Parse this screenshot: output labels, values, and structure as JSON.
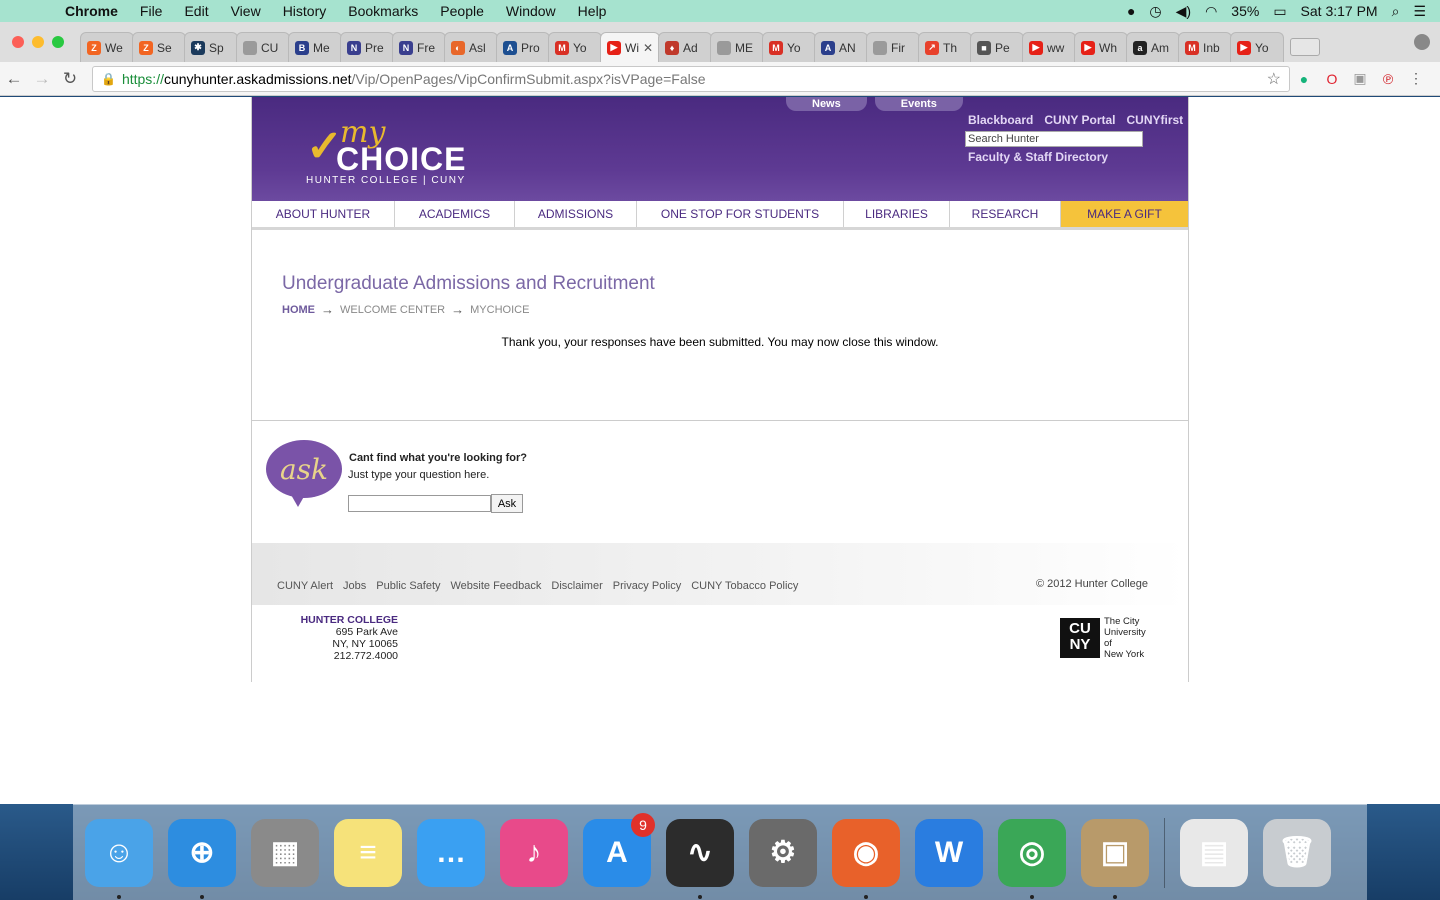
{
  "menubar": {
    "app": "Chrome",
    "items": [
      "File",
      "Edit",
      "View",
      "History",
      "Bookmarks",
      "People",
      "Window",
      "Help"
    ],
    "battery": "35%",
    "clock": "Sat 3:17 PM"
  },
  "tabs": [
    {
      "label": "We",
      "color": "#f26522",
      "glyph": "Z"
    },
    {
      "label": "Se",
      "color": "#f26522",
      "glyph": "Z"
    },
    {
      "label": "Sp",
      "color": "#1b3a5c",
      "glyph": "✱"
    },
    {
      "label": "CU",
      "color": "#9a9a9a",
      "glyph": ""
    },
    {
      "label": "Me",
      "color": "#2b3f8c",
      "glyph": "B"
    },
    {
      "label": "Pre",
      "color": "#3a3f8f",
      "glyph": "N"
    },
    {
      "label": "Fre",
      "color": "#3a3f8f",
      "glyph": "N"
    },
    {
      "label": "Asl",
      "color": "#e8672a",
      "glyph": "◐"
    },
    {
      "label": "Pro",
      "color": "#1d4f91",
      "glyph": "A"
    },
    {
      "label": "Yo",
      "color": "#d93025",
      "glyph": "M"
    },
    {
      "label": "Wi",
      "color": "#e62117",
      "glyph": "▶"
    },
    {
      "label": "Ad",
      "color": "#c0392b",
      "glyph": "♦"
    },
    {
      "label": "ME",
      "color": "#9a9a9a",
      "glyph": ""
    },
    {
      "label": "Yo",
      "color": "#d93025",
      "glyph": "M"
    },
    {
      "label": "AN",
      "color": "#2b3f8c",
      "glyph": "A"
    },
    {
      "label": "Fir",
      "color": "#9a9a9a",
      "glyph": ""
    },
    {
      "label": "Th",
      "color": "#e8412c",
      "glyph": "↗"
    },
    {
      "label": "Pe",
      "color": "#555555",
      "glyph": "■"
    },
    {
      "label": "ww",
      "color": "#e62117",
      "glyph": "▶"
    },
    {
      "label": "Wh",
      "color": "#e62117",
      "glyph": "▶"
    },
    {
      "label": "Am",
      "color": "#222222",
      "glyph": "a"
    },
    {
      "label": "Inb",
      "color": "#d93025",
      "glyph": "M"
    },
    {
      "label": "Yo",
      "color": "#e62117",
      "glyph": "▶"
    }
  ],
  "active_tab_index": 10,
  "address": {
    "scheme": "https://",
    "host": "cunyhunter.askadmissions.net",
    "path": "/Vip/OpenPages/VipConfirmSubmit.aspx?isVPage=False"
  },
  "site": {
    "top_tabs": [
      "News",
      "Events"
    ],
    "logo": {
      "my": "my",
      "choice": "CHOICE",
      "sub": "HUNTER COLLEGE | CUNY"
    },
    "top_links": [
      "Blackboard",
      "CUNY Portal",
      "CUNYfirst"
    ],
    "search_placeholder": "Search Hunter",
    "faculty_link": "Faculty & Staff Directory",
    "nav": [
      "ABOUT HUNTER",
      "ACADEMICS",
      "ADMISSIONS",
      "ONE STOP FOR STUDENTS",
      "LIBRARIES",
      "RESEARCH",
      "MAKE A GIFT"
    ],
    "page_title": "Undergraduate Admissions and Recruitment",
    "breadcrumb": [
      "HOME",
      "WELCOME CENTER",
      "MYCHOICE"
    ],
    "message": "Thank you, your responses have been submitted. You may now close this window.",
    "ask": {
      "bubble": "ask",
      "question": "Cant find what you're looking for?",
      "hint": "Just type your question here.",
      "button": "Ask"
    },
    "footer_links": [
      "CUNY Alert",
      "Jobs",
      "Public Safety",
      "Website Feedback",
      "Disclaimer",
      "Privacy Policy",
      "CUNY Tobacco Policy"
    ],
    "copyright": "© 2012 Hunter College",
    "address_lines": [
      "HUNTER COLLEGE",
      "695 Park Ave",
      "NY, NY 10065",
      "212.772.4000"
    ],
    "cuny_mark": "CU\nNY",
    "cuny_text": [
      "The City",
      "University",
      "of",
      "New York"
    ]
  },
  "dock": [
    {
      "name": "finder-icon",
      "color": "#4aa3e8",
      "glyph": "☺"
    },
    {
      "name": "safari-icon",
      "color": "#2d8de0",
      "glyph": "⊕"
    },
    {
      "name": "calculator-icon",
      "color": "#8a8a8a",
      "glyph": "▦"
    },
    {
      "name": "notes-icon",
      "color": "#f6e27a",
      "glyph": "≡"
    },
    {
      "name": "messages-icon",
      "color": "#3aa0f2",
      "glyph": "…"
    },
    {
      "name": "itunes-icon",
      "color": "#e84a8a",
      "glyph": "♪"
    },
    {
      "name": "app-store-icon",
      "color": "#2a8ce8",
      "glyph": "A",
      "badge": "9"
    },
    {
      "name": "activity-monitor-icon",
      "color": "#2c2c2c",
      "glyph": "∿"
    },
    {
      "name": "system-preferences-icon",
      "color": "#6a6a6a",
      "glyph": "⚙"
    },
    {
      "name": "firefox-icon",
      "color": "#e8612a",
      "glyph": "◉"
    },
    {
      "name": "word-icon",
      "color": "#2a7de0",
      "glyph": "W"
    },
    {
      "name": "chrome-icon",
      "color": "#3aa757",
      "glyph": "◎"
    },
    {
      "name": "preview-icon",
      "color": "#b89a6a",
      "glyph": "▣"
    },
    {
      "name": "document-icon",
      "color": "#e8e8e8",
      "glyph": "▤"
    },
    {
      "name": "trash-icon",
      "color": "#c8ccd0",
      "glyph": "🗑"
    }
  ]
}
